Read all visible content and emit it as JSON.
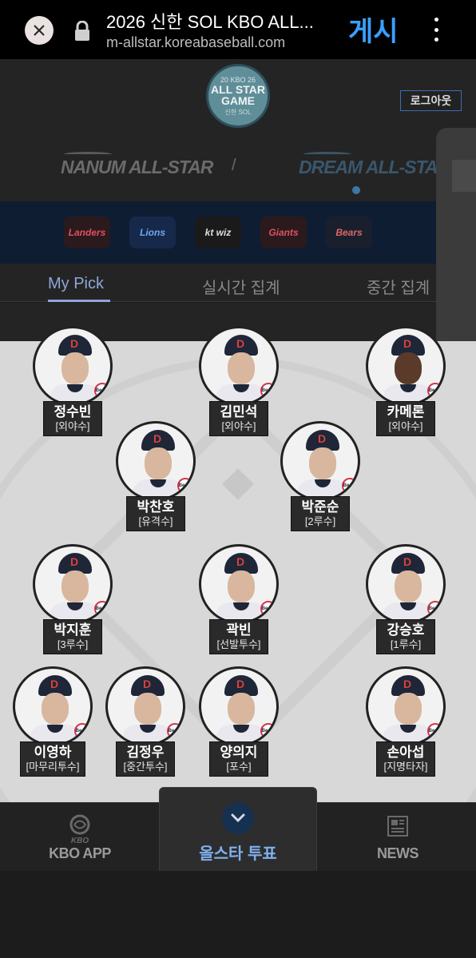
{
  "browser": {
    "title": "2026 신한 SOL KBO ALL...",
    "url": "m-allstar.koreabaseball.com",
    "share_label": "게시"
  },
  "header": {
    "logo_line1": "20 KBO 26",
    "logo_line2a": "ALL STAR",
    "logo_line2b": "GAME",
    "logo_line3": "신한 SOL",
    "logout_label": "로그아웃",
    "nanum_label": "NANUM ALL-STAR",
    "dream_label": "DREAM ALL-STAR",
    "separator": "/"
  },
  "teams": [
    {
      "label": "Landers",
      "color": "#c8102e"
    },
    {
      "label": "Lions",
      "color": "#1d6fd8"
    },
    {
      "label": "kt wiz",
      "color": "#222222"
    },
    {
      "label": "Giants",
      "color": "#c8102e"
    },
    {
      "label": "Bears",
      "color": "#1e2638"
    }
  ],
  "tabs": {
    "my_pick": "My Pick",
    "live": "실시간 집계",
    "interim": "중간 집계"
  },
  "players": [
    {
      "name": "정수빈",
      "position": "[외야수]"
    },
    {
      "name": "김민석",
      "position": "[외야수]"
    },
    {
      "name": "카메론",
      "position": "[외야수]"
    },
    {
      "name": "박찬호",
      "position": "[유격수]"
    },
    {
      "name": "박준순",
      "position": "[2루수]"
    },
    {
      "name": "박지훈",
      "position": "[3루수]"
    },
    {
      "name": "곽빈",
      "position": "[선발투수]"
    },
    {
      "name": "강승호",
      "position": "[1루수]"
    },
    {
      "name": "이영하",
      "position": "[마무리투수]"
    },
    {
      "name": "김정우",
      "position": "[중간투수]"
    },
    {
      "name": "양의지",
      "position": "[포수]"
    },
    {
      "name": "손아섭",
      "position": "[지명타자]"
    }
  ],
  "badge_label": "Bears",
  "nav": {
    "kbo_app": "KBO APP",
    "kbo_mark": "KBO",
    "vote": "올스타 투표",
    "news": "NEWS"
  }
}
